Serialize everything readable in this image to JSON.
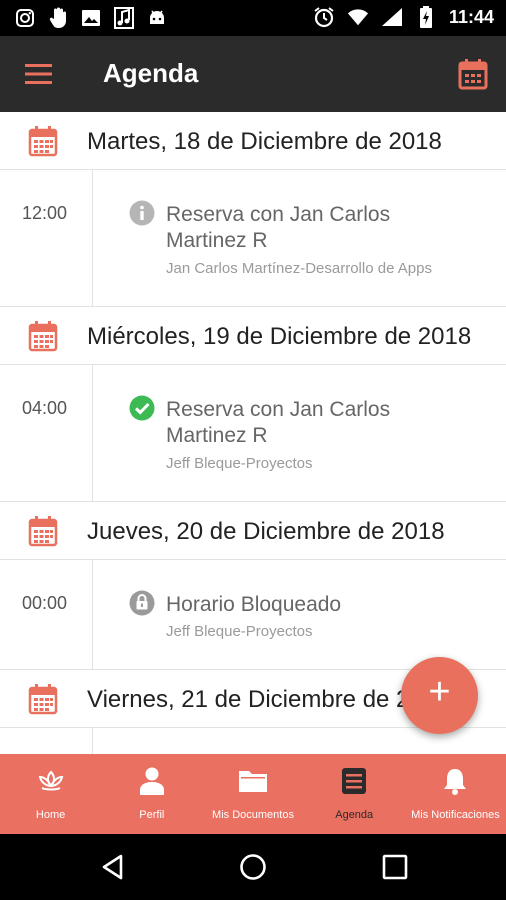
{
  "status_bar": {
    "time": "11:44",
    "left_icons": [
      "instagram-icon",
      "hand-icon",
      "image-icon",
      "music-icon",
      "android-icon"
    ],
    "right_icons": [
      "alarm-icon",
      "wifi-icon",
      "signal-icon",
      "battery-charging-icon"
    ]
  },
  "app_bar": {
    "title": "Agenda",
    "menu_icon": "hamburger-menu-icon",
    "calendar_icon": "calendar-icon"
  },
  "colors": {
    "accent": "#e8705c",
    "app_bar": "#2b2b2b",
    "nav_bg": "#ea7061",
    "success": "#3dba54",
    "muted_icon": "#b5b5b5"
  },
  "agenda": {
    "days": [
      {
        "date": "Martes, 18 de Diciembre de 2018",
        "events": [
          {
            "time": "12:00",
            "status_icon": "info-icon",
            "title": "Reserva con Jan Carlos Martinez R",
            "subtitle": "Jan Carlos Martínez-Desarrollo de Apps"
          }
        ]
      },
      {
        "date": "Miércoles, 19 de Diciembre de 2018",
        "events": [
          {
            "time": "04:00",
            "status_icon": "check-circle-icon",
            "title": "Reserva con Jan Carlos Martinez R",
            "subtitle": "Jeff Bleque-Proyectos"
          }
        ]
      },
      {
        "date": "Jueves, 20 de Diciembre de 2018",
        "events": [
          {
            "time": "00:00",
            "status_icon": "lock-icon",
            "title": "Horario Bloqueado",
            "subtitle": "Jeff Bleque-Proyectos"
          }
        ]
      },
      {
        "date": "Viernes, 21 de Diciembre de 2018",
        "events": []
      }
    ]
  },
  "fab": {
    "label": "+"
  },
  "bottom_nav": {
    "items": [
      {
        "label": "Home",
        "icon": "lotus-icon"
      },
      {
        "label": "Perfil",
        "icon": "user-icon"
      },
      {
        "label": "Mis Documentos",
        "icon": "folder-icon"
      },
      {
        "label": "Agenda",
        "icon": "agenda-list-icon",
        "active": true
      },
      {
        "label": "Mis Notificaciones",
        "icon": "bell-icon"
      }
    ]
  },
  "system_nav": [
    "back-icon",
    "home-icon",
    "recents-icon"
  ]
}
